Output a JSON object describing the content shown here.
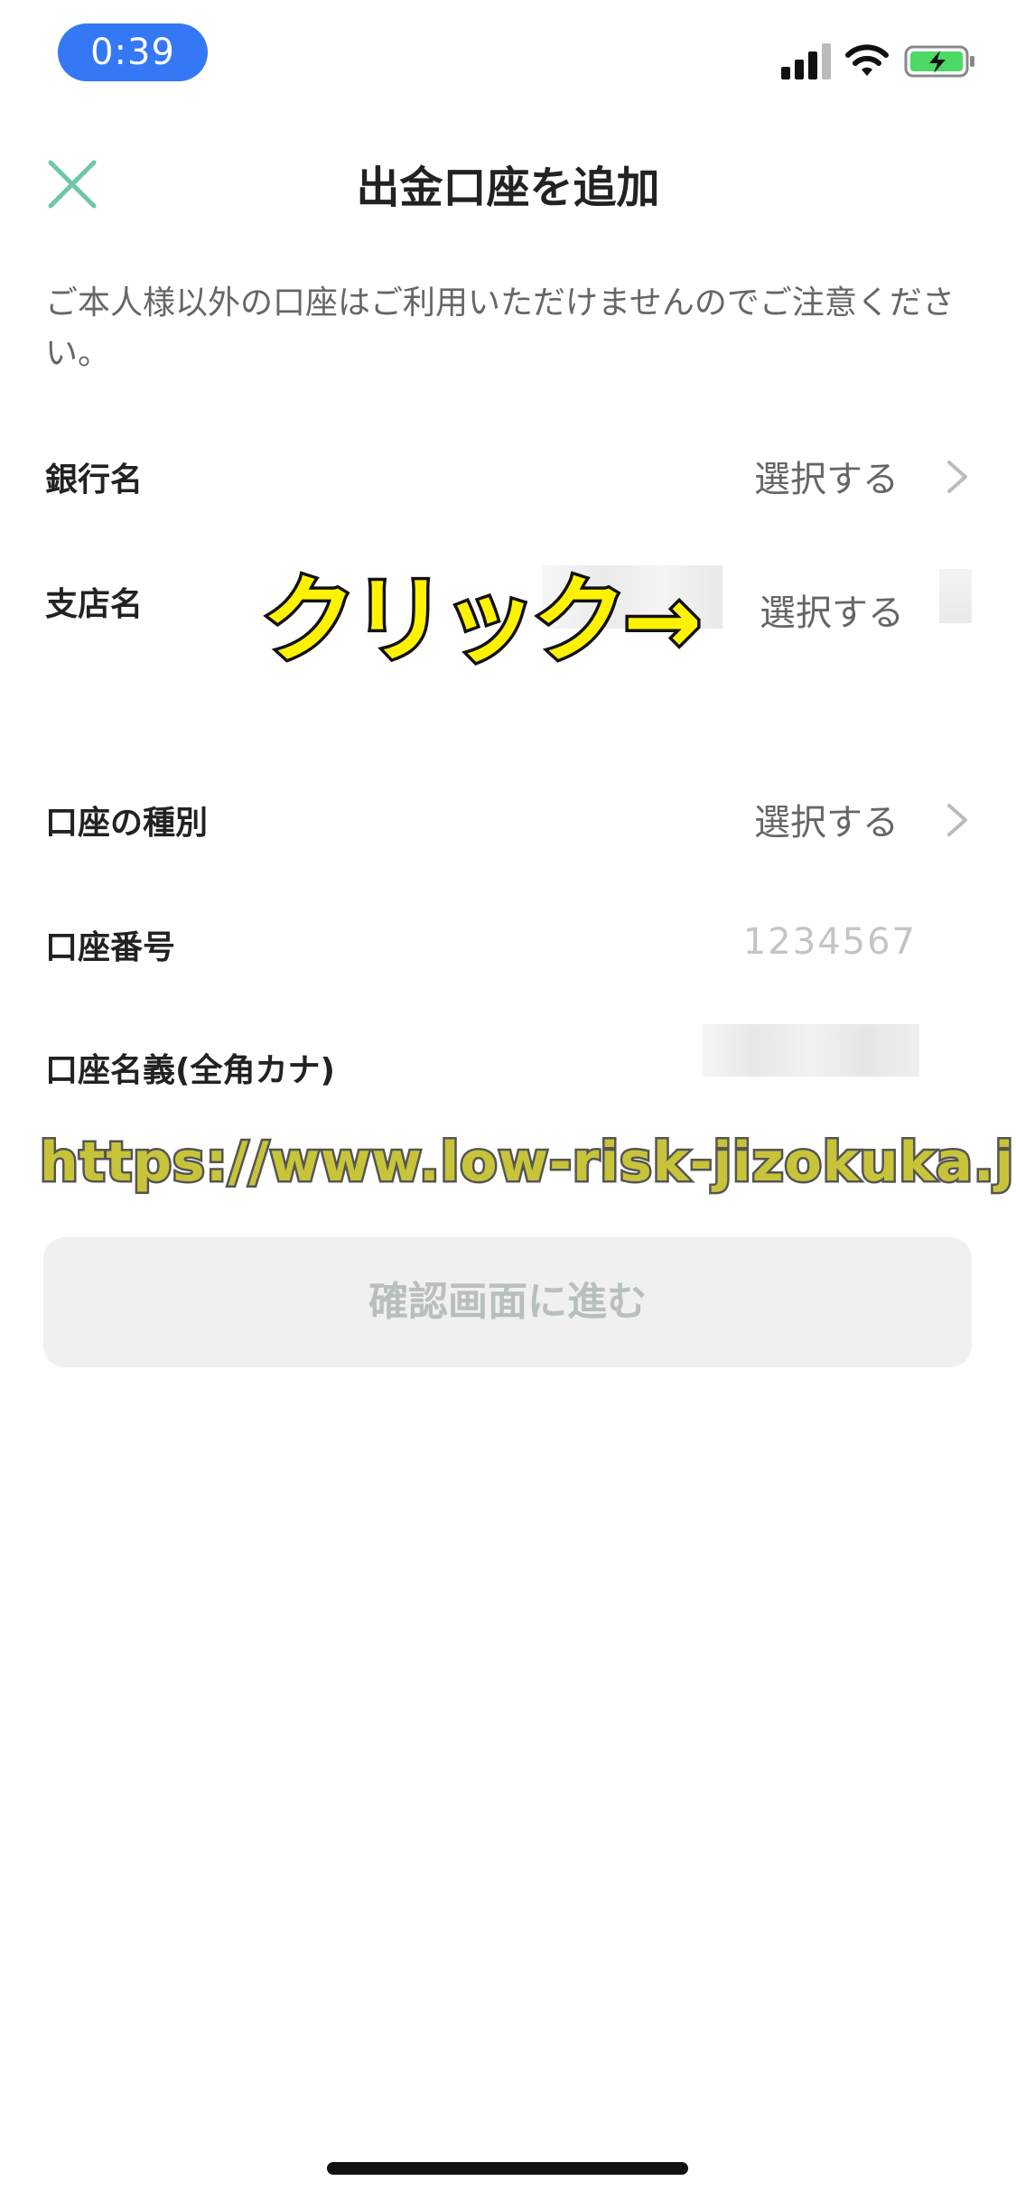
{
  "status_bar": {
    "time": "0:39",
    "icons": [
      "signal-icon",
      "wifi-icon",
      "battery-charging-icon"
    ],
    "accent": "#3478f6",
    "battery_color": "#4cd964"
  },
  "header": {
    "title": "出金口座を追加",
    "close_icon": "close-icon",
    "close_color": "#6cc9a4"
  },
  "notice": "ご本人様以外の口座はご利用いただけませんのでご注意ください。",
  "form": {
    "bank": {
      "label": "銀行名",
      "value": "選択する"
    },
    "branch": {
      "label": "支店名",
      "value": "選択する"
    },
    "account_type": {
      "label": "口座の種別",
      "value": "選択する"
    },
    "account_number": {
      "label": "口座番号",
      "placeholder": "1234567"
    },
    "account_holder": {
      "label": "口座名義(全角カナ)"
    }
  },
  "annotation": "クリック→",
  "watermark": "https://www.low-risk-jizokuka.jp/",
  "submit_button": "確認画面に進む"
}
